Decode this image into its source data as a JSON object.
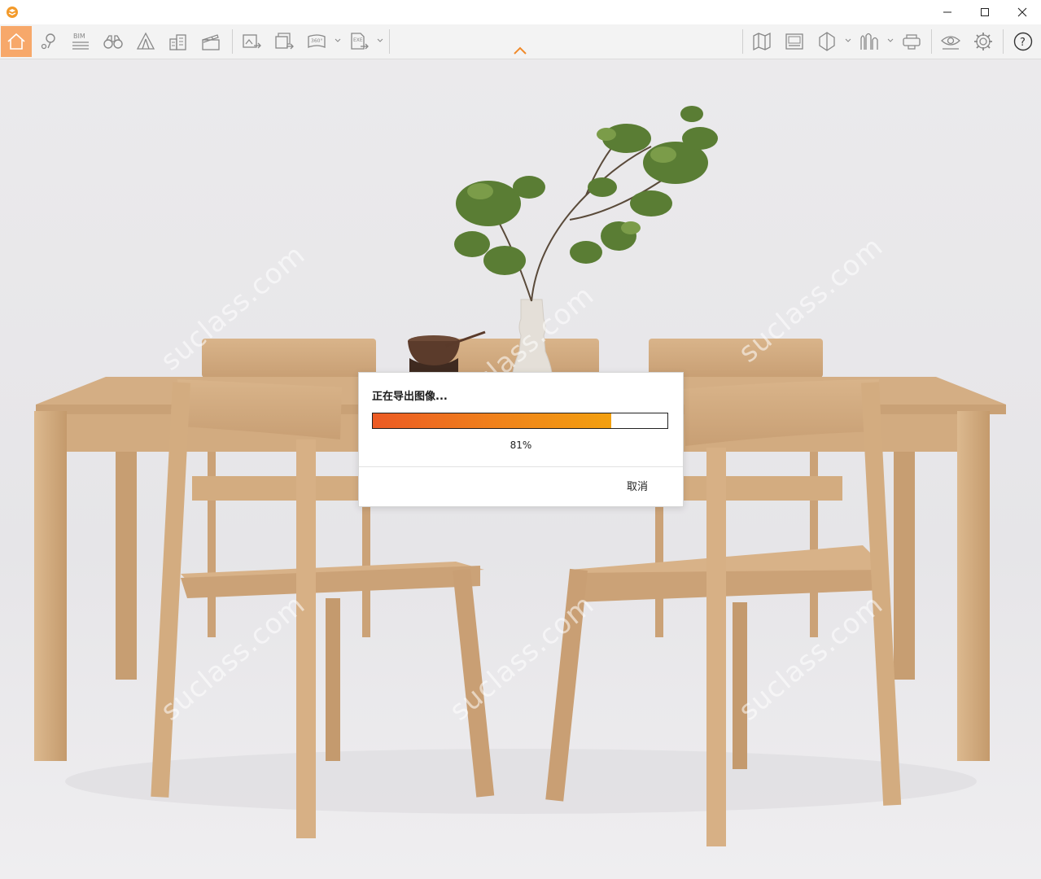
{
  "window": {
    "controls": {
      "minimize": "minimize-icon",
      "maximize": "maximize-icon",
      "close": "close-icon"
    }
  },
  "toolbar": {
    "left_tools": [
      {
        "icon": "home-icon",
        "active": true
      },
      {
        "icon": "location-pin-icon"
      },
      {
        "icon": "bim-icon",
        "label": "BIM"
      },
      {
        "icon": "binoculars-icon"
      },
      {
        "icon": "tent-icon"
      },
      {
        "icon": "buildings-icon"
      },
      {
        "icon": "clapperboard-icon"
      }
    ],
    "export_tools": [
      {
        "icon": "export-image-icon"
      },
      {
        "icon": "export-batch-icon"
      },
      {
        "icon": "export-360-icon",
        "label": "360°",
        "has_dropdown": true
      },
      {
        "icon": "export-exe-icon",
        "label": "EXE",
        "has_dropdown": true
      }
    ],
    "right_tools": [
      {
        "icon": "map-icon"
      },
      {
        "icon": "media-panel-icon"
      },
      {
        "icon": "section-icon",
        "has_dropdown": true
      },
      {
        "icon": "cityscape-icon",
        "has_dropdown": true
      },
      {
        "icon": "vr-headset-icon"
      },
      {
        "icon": "eye-icon"
      },
      {
        "icon": "gear-icon"
      },
      {
        "icon": "help-icon",
        "label": "?"
      }
    ],
    "collapse_icon": "chevron-up-icon"
  },
  "accent_color": "#f7a86a",
  "watermark_text": "suclass.com",
  "dialog": {
    "title": "正在导出图像...",
    "progress": 0.81,
    "progress_text": "81%",
    "cancel_label": "取消"
  }
}
